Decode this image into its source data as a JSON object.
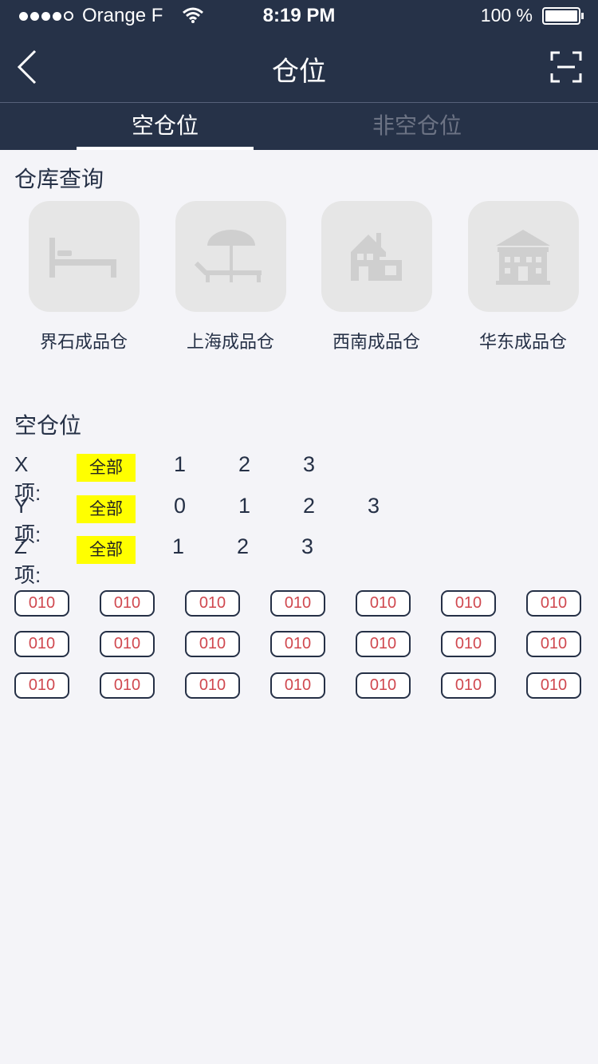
{
  "status": {
    "carrier": "Orange F",
    "time": "8:19 PM",
    "battery": "100 %"
  },
  "nav": {
    "title": "仓位",
    "back_icon": "chevron-left-icon",
    "scan_icon": "scan-icon"
  },
  "tabs": [
    {
      "label": "空仓位",
      "active": true
    },
    {
      "label": "非空仓位",
      "active": false
    }
  ],
  "warehouse": {
    "title": "仓库查询",
    "items": [
      {
        "label": "界石成品仓",
        "icon": "bed-icon"
      },
      {
        "label": "上海成品仓",
        "icon": "umbrella-lounger-icon"
      },
      {
        "label": "西南成品仓",
        "icon": "house-icon"
      },
      {
        "label": "华东成品仓",
        "icon": "building-icon"
      }
    ]
  },
  "empty_slots": {
    "title": "空仓位",
    "filters": [
      {
        "label": "X项:",
        "all": "全部",
        "options": [
          "1",
          "2",
          "3"
        ]
      },
      {
        "label": "Y项:",
        "all": "全部",
        "options": [
          "0",
          "1",
          "2",
          "3"
        ]
      },
      {
        "label": "Z项:",
        "all": "全部",
        "options": [
          "1",
          "2",
          "3"
        ]
      }
    ],
    "chips": [
      "010",
      "010",
      "010",
      "010",
      "010",
      "010",
      "010",
      "010",
      "010",
      "010",
      "010",
      "010",
      "010",
      "010",
      "010",
      "010",
      "010",
      "010",
      "010",
      "010",
      "010"
    ]
  },
  "colors": {
    "nav_bg": "#263248",
    "highlight": "#ffff00",
    "chip_text": "#d0484f"
  }
}
